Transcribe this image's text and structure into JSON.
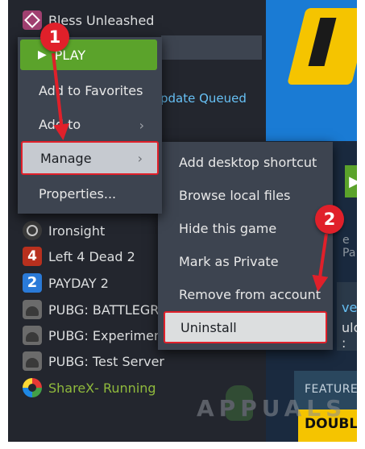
{
  "library": {
    "top_game": "Bless Unleashed",
    "status": "Update Queued",
    "games": [
      {
        "name": "Ironsight"
      },
      {
        "name": "Left 4 Dead 2"
      },
      {
        "name": "PAYDAY 2"
      },
      {
        "name": "PUBG: BATTLEGROUNDS"
      },
      {
        "name": "PUBG: Experimental Server"
      },
      {
        "name": "PUBG: Test Server"
      },
      {
        "name": "ShareX",
        "status": " - Running"
      }
    ]
  },
  "context_menu": {
    "play_label": "PLAY",
    "items": [
      "Add to Favorites",
      "Add to",
      "Manage",
      "Properties..."
    ]
  },
  "manage_submenu": {
    "items": [
      "Add desktop shortcut",
      "Browse local files",
      "Hide this game",
      "Mark as Private",
      "Remove from account",
      "Uninstall"
    ]
  },
  "right_pane": {
    "featured_label": "FEATURED",
    "banner_text": "DOUBL",
    "partial_pa": "e Pa",
    "partial_ve": "ve",
    "partial_uld": "uld :"
  },
  "watermark": "APPUALS",
  "callouts": [
    "1",
    "2"
  ],
  "colors": {
    "highlight": "#e0202a",
    "play": "#5ba32b",
    "status": "#67c1f5",
    "running": "#90ba3c"
  }
}
